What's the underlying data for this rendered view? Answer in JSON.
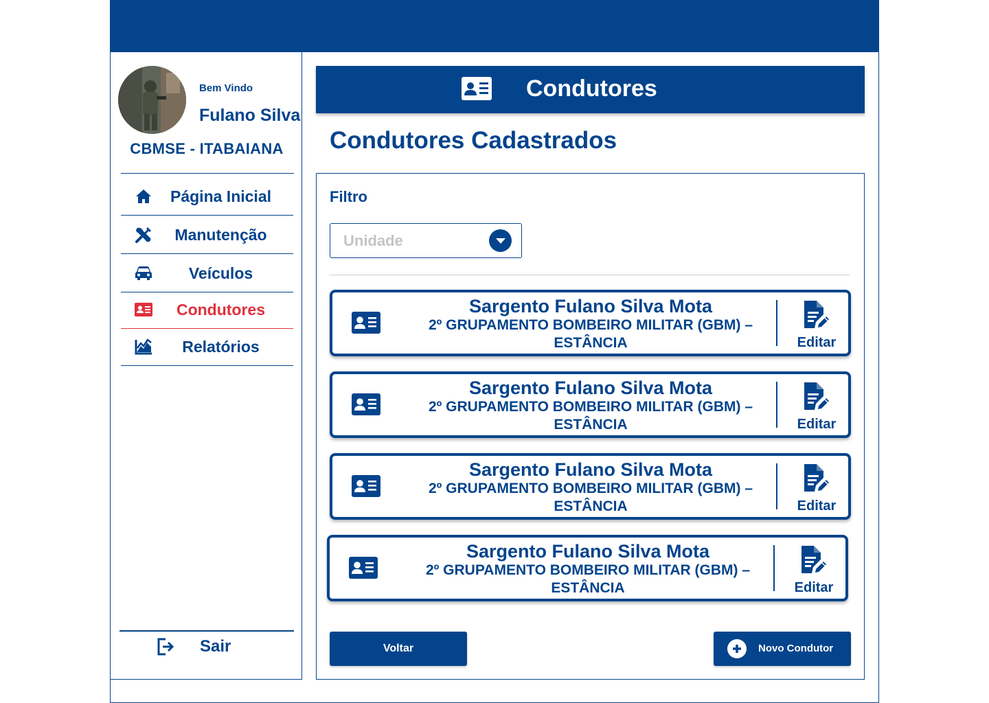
{
  "colors": {
    "primary": "#04448c",
    "active": "#e0303c",
    "placeholder": "#c4c4c4"
  },
  "sidebar": {
    "welcome": "Bem Vindo",
    "user_name": "Fulano Silva",
    "unit": "CBMSE - ITABAIANA",
    "items": [
      {
        "label": "Página Inicial",
        "icon": "home-icon",
        "active": false
      },
      {
        "label": "Manutenção",
        "icon": "tools-icon",
        "active": false
      },
      {
        "label": "Veículos",
        "icon": "car-icon",
        "active": false
      },
      {
        "label": "Condutores",
        "icon": "id-card-icon",
        "active": true
      },
      {
        "label": "Relatórios",
        "icon": "chart-line-icon",
        "active": false
      }
    ],
    "logout_label": "Sair"
  },
  "header": {
    "title": "Condutores"
  },
  "page_title": "Condutores Cadastrados",
  "filter": {
    "label": "Filtro",
    "select_placeholder": "Unidade"
  },
  "drivers": [
    {
      "name": "Sargento Fulano Silva Mota",
      "unit_line1": "2º GRUPAMENTO BOMBEIRO MILITAR (GBM) –",
      "unit_line2": "ESTÂNCIA",
      "edit_label": "Editar"
    },
    {
      "name": "Sargento Fulano Silva Mota",
      "unit_line1": "2º GRUPAMENTO BOMBEIRO MILITAR (GBM) –",
      "unit_line2": "ESTÂNCIA",
      "edit_label": "Editar"
    },
    {
      "name": "Sargento Fulano Silva Mota",
      "unit_line1": "2º GRUPAMENTO BOMBEIRO MILITAR (GBM) –",
      "unit_line2": "ESTÂNCIA",
      "edit_label": "Editar"
    },
    {
      "name": "Sargento Fulano Silva Mota",
      "unit_line1": "2º GRUPAMENTO BOMBEIRO MILITAR (GBM) –",
      "unit_line2": "ESTÂNCIA",
      "edit_label": "Editar"
    }
  ],
  "buttons": {
    "back": "Voltar",
    "new_driver": "Novo Condutor"
  }
}
